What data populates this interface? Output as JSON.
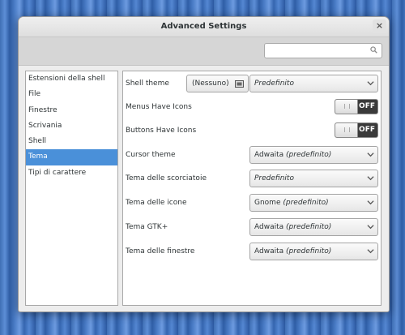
{
  "window": {
    "title": "Advanced Settings",
    "close_glyph": "×"
  },
  "search": {
    "placeholder": ""
  },
  "sidebar": {
    "items": [
      {
        "label": "Estensioni della shell",
        "selected": false
      },
      {
        "label": "File",
        "selected": false
      },
      {
        "label": "Finestre",
        "selected": false
      },
      {
        "label": "Scrivania",
        "selected": false
      },
      {
        "label": "Shell",
        "selected": false
      },
      {
        "label": "Tema",
        "selected": true
      },
      {
        "label": "Tipi di carattere",
        "selected": false
      }
    ]
  },
  "settings": {
    "shell_theme": {
      "label": "Shell theme",
      "file_button": "(Nessuno)",
      "value": "Predefinito"
    },
    "menus_have_icons": {
      "label": "Menus Have Icons",
      "state": "OFF"
    },
    "buttons_have_icons": {
      "label": "Buttons Have Icons",
      "state": "OFF"
    },
    "cursor_theme": {
      "label": "Cursor theme",
      "value": "Adwaita",
      "suffix": "(predefinito)"
    },
    "keybinding_theme": {
      "label": "Tema delle scorciatoie",
      "value": "Predefinito"
    },
    "icon_theme": {
      "label": "Tema delle icone",
      "value": "Gnome",
      "suffix": "(predefinito)"
    },
    "gtk_theme": {
      "label": "Tema GTK+",
      "value": "Adwaita",
      "suffix": "(predefinito)"
    },
    "window_theme": {
      "label": "Tema delle finestre",
      "value": "Adwaita",
      "suffix": "(predefinito)"
    }
  },
  "colors": {
    "selection": "#4a90d9",
    "switch_off_bg": "#3a3a3a"
  },
  "icons": {
    "search": "search-icon",
    "close": "close-icon",
    "chevron": "chevron-down-icon",
    "folder": "folder-icon"
  }
}
